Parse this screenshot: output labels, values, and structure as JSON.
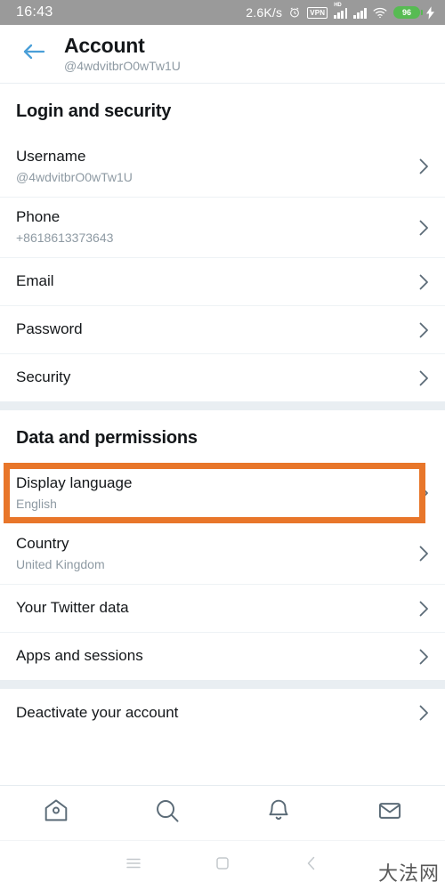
{
  "status_bar": {
    "time": "16:43",
    "network_speed": "2.6K/s",
    "vpn_label": "VPN",
    "hd_label": "HD",
    "battery_level": "96"
  },
  "header": {
    "title": "Account",
    "handle": "@4wdvitbrO0wTw1U"
  },
  "sections": [
    {
      "title": "Login and security",
      "rows": [
        {
          "label": "Username",
          "value": "@4wdvitbrO0wTw1U"
        },
        {
          "label": "Phone",
          "value": "+8618613373643"
        },
        {
          "label": "Email",
          "value": ""
        },
        {
          "label": "Password",
          "value": ""
        },
        {
          "label": "Security",
          "value": ""
        }
      ]
    },
    {
      "title": "Data and permissions",
      "rows": [
        {
          "label": "Display language",
          "value": "English"
        },
        {
          "label": "Country",
          "value": "United Kingdom"
        },
        {
          "label": "Your Twitter data",
          "value": ""
        },
        {
          "label": "Apps and sessions",
          "value": ""
        }
      ]
    },
    {
      "title": "",
      "rows": [
        {
          "label": "Deactivate your account",
          "value": ""
        }
      ]
    }
  ],
  "highlight": {
    "target_label": "Display language",
    "color": "#e8762a"
  },
  "tab_bar": {
    "tabs": [
      {
        "name": "home",
        "label": "Home"
      },
      {
        "name": "search",
        "label": "Search"
      },
      {
        "name": "notifications",
        "label": "Notifications"
      },
      {
        "name": "messages",
        "label": "Messages"
      }
    ]
  },
  "android_nav": {
    "recents_label": "Recents",
    "home_label": "Home",
    "back_label": "Back"
  },
  "watermark": {
    "text": "大法网"
  },
  "colors": {
    "accent_blue": "#4a9fd8",
    "highlight_orange": "#e8762a",
    "battery_green": "#57bb53",
    "text_primary": "#14171a",
    "text_secondary": "#8e9aa3"
  }
}
